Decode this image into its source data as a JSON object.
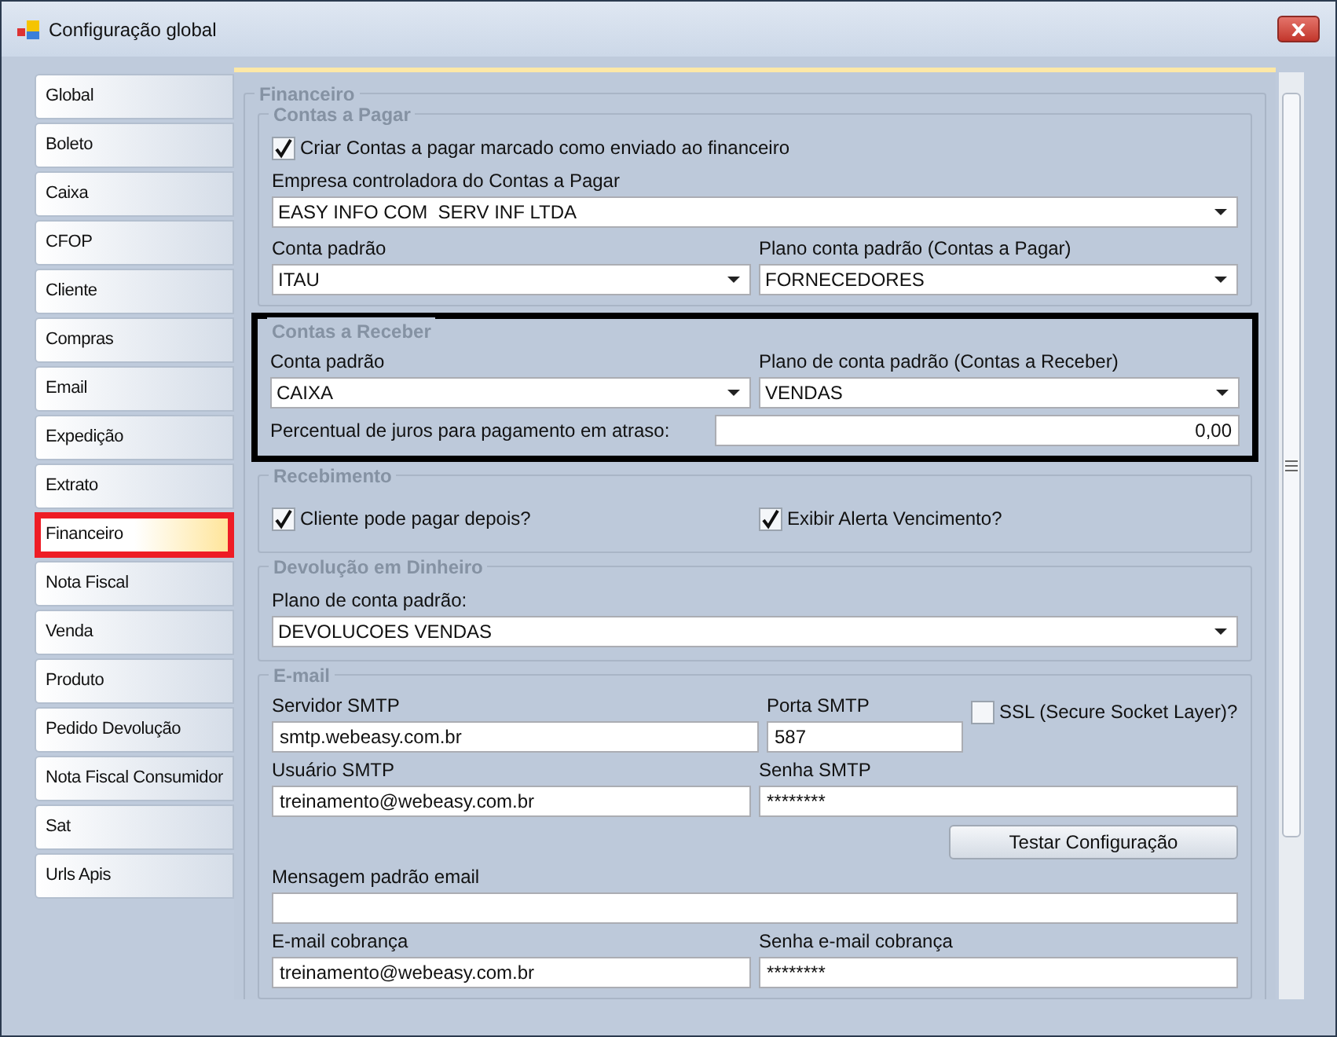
{
  "window": {
    "title": "Configuração global"
  },
  "sidebar": {
    "items": [
      {
        "label": "Global",
        "selected": false
      },
      {
        "label": "Boleto",
        "selected": false
      },
      {
        "label": "Caixa",
        "selected": false
      },
      {
        "label": "CFOP",
        "selected": false
      },
      {
        "label": "Cliente",
        "selected": false
      },
      {
        "label": "Compras",
        "selected": false
      },
      {
        "label": "Email",
        "selected": false
      },
      {
        "label": "Expedição",
        "selected": false
      },
      {
        "label": "Extrato",
        "selected": false
      },
      {
        "label": "Financeiro",
        "selected": true
      },
      {
        "label": "Nota Fiscal",
        "selected": false
      },
      {
        "label": "Venda",
        "selected": false
      },
      {
        "label": "Produto",
        "selected": false
      },
      {
        "label": "Pedido Devolução",
        "selected": false
      },
      {
        "label": "Nota Fiscal Consumidor",
        "selected": false
      },
      {
        "label": "Sat",
        "selected": false
      },
      {
        "label": "Urls Apis",
        "selected": false
      }
    ]
  },
  "panel": {
    "title": "Financeiro",
    "contas_a_pagar": {
      "title": "Contas a Pagar",
      "checkbox": {
        "label": "Criar Contas a pagar marcado como enviado ao financeiro",
        "checked": true
      },
      "empresa": {
        "label": "Empresa controladora do Contas a Pagar",
        "value": "EASY INFO COM  SERV INF LTDA"
      },
      "conta": {
        "label": "Conta padrão",
        "value": "ITAU"
      },
      "plano": {
        "label": "Plano conta padrão (Contas a Pagar)",
        "value": "FORNECEDORES"
      }
    },
    "contas_a_receber": {
      "title": "Contas a Receber",
      "highlighted": true,
      "conta": {
        "label": "Conta padrão",
        "value": "CAIXA"
      },
      "plano": {
        "label": "Plano de conta padrão (Contas a Receber)",
        "value": "VENDAS"
      },
      "juros": {
        "label": "Percentual de juros para pagamento em atraso:",
        "value": "0,00"
      }
    },
    "recebimento": {
      "title": "Recebimento",
      "checkboxes": [
        {
          "label": "Cliente pode pagar depois?",
          "checked": true
        },
        {
          "label": "Exibir Alerta Vencimento?",
          "checked": true
        }
      ]
    },
    "devolucao": {
      "title": "Devolução em Dinheiro",
      "plano": {
        "label": "Plano de conta padrão:",
        "value": "DEVOLUCOES VENDAS"
      }
    },
    "email": {
      "title": "E-mail",
      "servidor": {
        "label": "Servidor SMTP",
        "value": "smtp.webeasy.com.br"
      },
      "porta": {
        "label": "Porta SMTP",
        "value": "587"
      },
      "ssl": {
        "label": "SSL (Secure Socket Layer)?",
        "checked": false
      },
      "usuario": {
        "label": "Usuário SMTP",
        "value": "treinamento@webeasy.com.br"
      },
      "senha": {
        "label": "Senha SMTP",
        "value": "********"
      },
      "testar": "Testar Configuração",
      "mensagem": {
        "label": "Mensagem padrão email"
      },
      "cobranca": {
        "label": "E-mail cobrança",
        "value": "treinamento@webeasy.com.br"
      },
      "senha_cobranca": {
        "label": "Senha e-mail cobrança",
        "value": "********"
      }
    }
  }
}
